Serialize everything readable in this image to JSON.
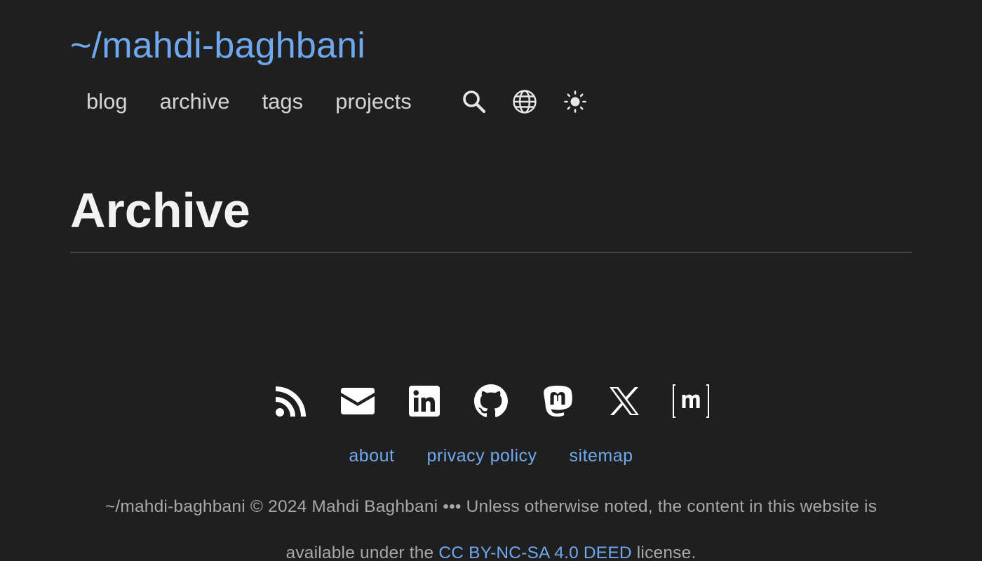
{
  "header": {
    "site_title": "~/mahdi-baghbani",
    "nav": [
      {
        "label": "blog"
      },
      {
        "label": "archive"
      },
      {
        "label": "tags"
      },
      {
        "label": "projects"
      }
    ],
    "icons": [
      "search-icon",
      "globe-icon",
      "sun-icon"
    ]
  },
  "main": {
    "page_title": "Archive"
  },
  "footer": {
    "social_icons": [
      "rss-icon",
      "email-icon",
      "linkedin-icon",
      "github-icon",
      "mastodon-icon",
      "x-icon",
      "matrix-icon"
    ],
    "links": [
      {
        "label": "about"
      },
      {
        "label": "privacy policy"
      },
      {
        "label": "sitemap"
      }
    ],
    "copyright_prefix": "~/mahdi-baghbani © 2024 Mahdi Baghbani ••• Unless otherwise noted, the content in this website is available under the ",
    "license_link": "CC BY-NC-SA 4.0 DEED",
    "copyright_suffix": " license."
  },
  "colors": {
    "background": "#1f1f1f",
    "accent": "#6fa8ee",
    "text": "#d4d4d4",
    "muted": "#a8a8a8"
  }
}
